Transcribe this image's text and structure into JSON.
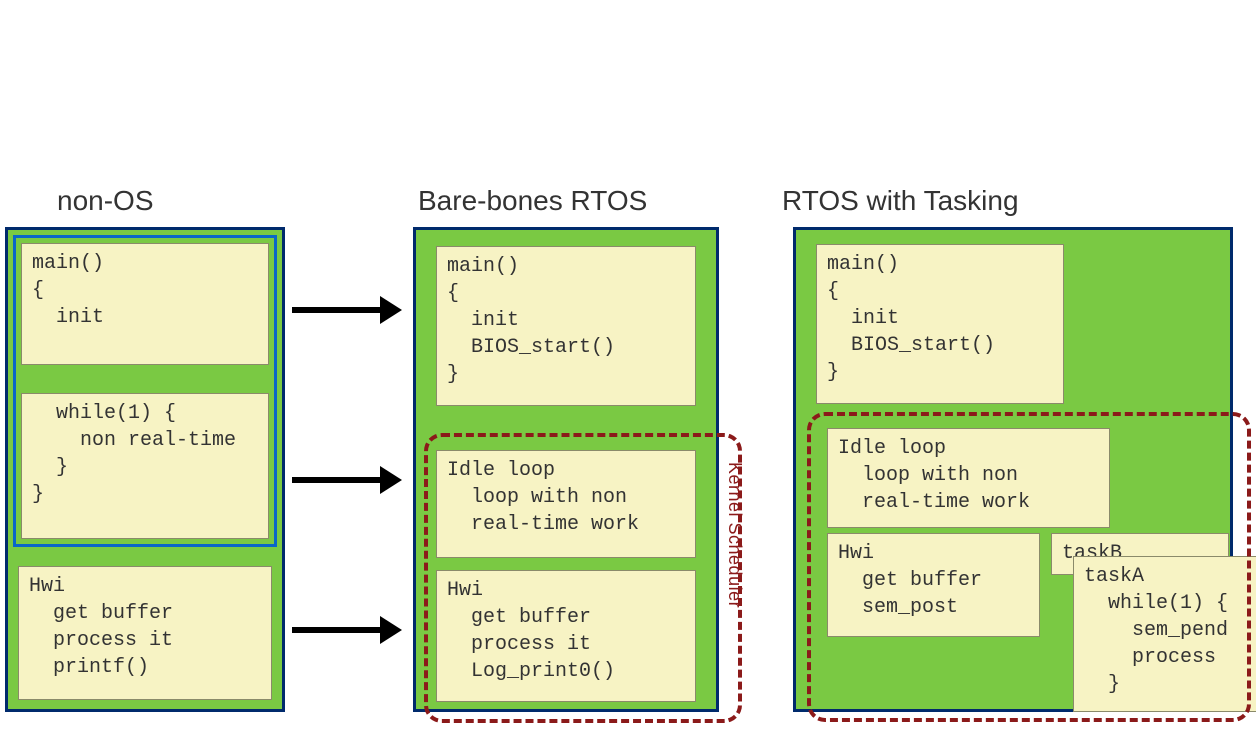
{
  "columns": {
    "nonos": {
      "title": "non-OS",
      "boxes": {
        "main": "main()\n{\n  init",
        "while": "  while(1) {\n    non real-time\n  }\n}",
        "hwi": "Hwi\n  get buffer\n  process it\n  printf()"
      }
    },
    "bare": {
      "title": "Bare-bones RTOS",
      "boxes": {
        "main": "main()\n{\n  init\n  BIOS_start()\n}",
        "idle": "Idle loop\n  loop with non\n  real-time work",
        "hwi": "Hwi\n  get buffer\n  process it\n  Log_print0()"
      },
      "kernel_label": "Kernel Scheduler"
    },
    "tasking": {
      "title": "RTOS with Tasking",
      "boxes": {
        "main": "main()\n{\n  init\n  BIOS_start()\n}",
        "idle": "Idle loop\n  loop with non\n  real-time work",
        "hwi": "Hwi\n  get buffer\n  sem_post",
        "taskB": "taskB",
        "taskA": "taskA\n  while(1) {\n    sem_pend\n    process\n  }"
      }
    }
  }
}
